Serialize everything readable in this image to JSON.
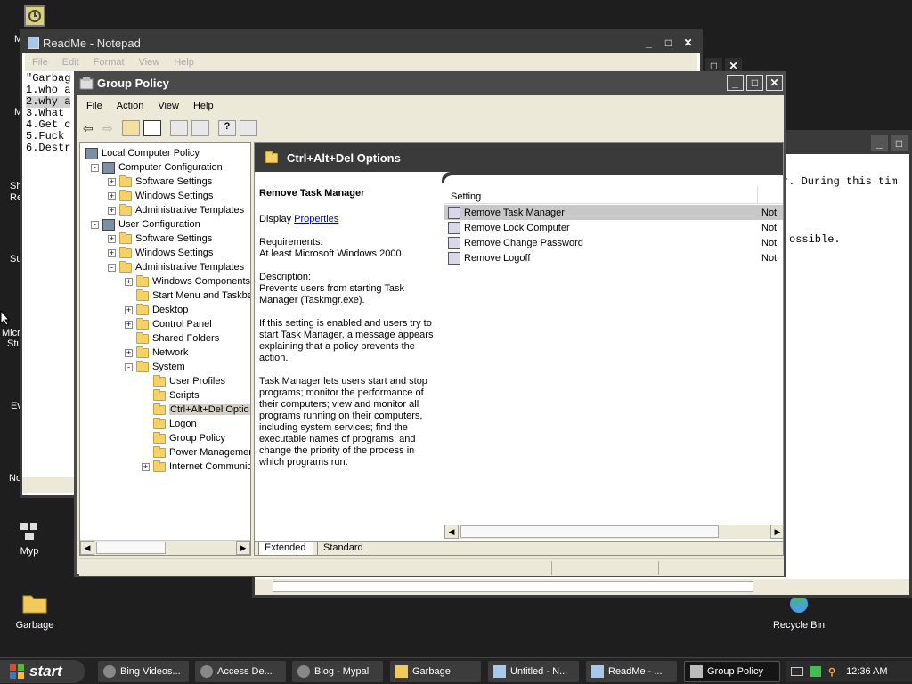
{
  "desktop": {
    "icons": [
      {
        "label": "Garbage",
        "icon": "folder-icon"
      },
      {
        "label": "Recycle Bin",
        "icon": "recycle-bin-icon"
      },
      {
        "label": "Myp",
        "icon": "network-icon"
      }
    ],
    "left_fragments": [
      "M",
      "M",
      "Sh",
      "Re",
      "Su",
      "Micr",
      "Stu",
      "Ev",
      "No"
    ]
  },
  "notepad": {
    "title": "ReadMe - Notepad",
    "menu": [
      "File",
      "Edit",
      "Format",
      "View",
      "Help"
    ],
    "lines": [
      "\"Garbag",
      "1.who a",
      "2.why a",
      "3.What",
      "4.Get c",
      "5.Fuck",
      "6.Destr"
    ]
  },
  "back_window": {
    "text_line1": "r. During this tim",
    "text_line2": "ossible."
  },
  "gp": {
    "title": "Group Policy",
    "menu": [
      "File",
      "Action",
      "View",
      "Help"
    ],
    "tree": [
      {
        "label": "Local Computer Policy",
        "level": 0,
        "exp": ""
      },
      {
        "label": "Computer Configuration",
        "level": 1,
        "exp": "-"
      },
      {
        "label": "Software Settings",
        "level": 2,
        "exp": "+"
      },
      {
        "label": "Windows Settings",
        "level": 2,
        "exp": "+"
      },
      {
        "label": "Administrative Templates",
        "level": 2,
        "exp": "+"
      },
      {
        "label": "User Configuration",
        "level": 1,
        "exp": "-"
      },
      {
        "label": "Software Settings",
        "level": 2,
        "exp": "+"
      },
      {
        "label": "Windows Settings",
        "level": 2,
        "exp": "+"
      },
      {
        "label": "Administrative Templates",
        "level": 2,
        "exp": "-"
      },
      {
        "label": "Windows Components",
        "level": 3,
        "exp": "+"
      },
      {
        "label": "Start Menu and Taskba",
        "level": 3,
        "exp": ""
      },
      {
        "label": "Desktop",
        "level": 3,
        "exp": "+"
      },
      {
        "label": "Control Panel",
        "level": 3,
        "exp": "+"
      },
      {
        "label": "Shared Folders",
        "level": 3,
        "exp": ""
      },
      {
        "label": "Network",
        "level": 3,
        "exp": "+"
      },
      {
        "label": "System",
        "level": 3,
        "exp": "-"
      },
      {
        "label": "User Profiles",
        "level": 4,
        "exp": ""
      },
      {
        "label": "Scripts",
        "level": 4,
        "exp": ""
      },
      {
        "label": "Ctrl+Alt+Del Optio",
        "level": 4,
        "exp": "",
        "selected": true
      },
      {
        "label": "Logon",
        "level": 4,
        "exp": ""
      },
      {
        "label": "Group Policy",
        "level": 4,
        "exp": ""
      },
      {
        "label": "Power Managemen",
        "level": 4,
        "exp": ""
      },
      {
        "label": "Internet Communic",
        "level": 4,
        "exp": "+"
      }
    ],
    "header": "Ctrl+Alt+Del Options",
    "detail": {
      "title": "Remove Task Manager",
      "display_prefix": "Display",
      "properties_link": "Properties",
      "requirements_label": "Requirements:",
      "requirements": "At least Microsoft Windows 2000",
      "description_label": "Description:",
      "desc1": "Prevents users from starting Task Manager (Taskmgr.exe).",
      "desc2": "If this setting is enabled and users try to start Task Manager, a message appears explaining that a policy prevents the action.",
      "desc3": "Task Manager lets users start and stop programs; monitor the performance of their computers; view and monitor all programs running on their computers, including system services; find the executable names of programs; and change the priority of the process in which programs run."
    },
    "settings_col": "Setting",
    "settings": [
      {
        "name": "Remove Task Manager",
        "state": "Not",
        "selected": true
      },
      {
        "name": "Remove Lock Computer",
        "state": "Not"
      },
      {
        "name": "Remove Change Password",
        "state": "Not"
      },
      {
        "name": "Remove Logoff",
        "state": "Not"
      }
    ],
    "tabs": [
      "Extended",
      "Standard"
    ]
  },
  "taskbar": {
    "start": "start",
    "buttons": [
      "Bing Videos...",
      "Access De...",
      "Blog - Mypal",
      "Garbage",
      "Untitled - N...",
      "ReadMe - ...",
      "Group Policy"
    ],
    "clock": "12:36 AM"
  },
  "colors": {
    "desktop": "#1e1e1e",
    "active_title": "#4a4a4a",
    "inactive_title": "#3a3a3a",
    "link": "#0000cc",
    "selection": "#c8c8c8"
  }
}
